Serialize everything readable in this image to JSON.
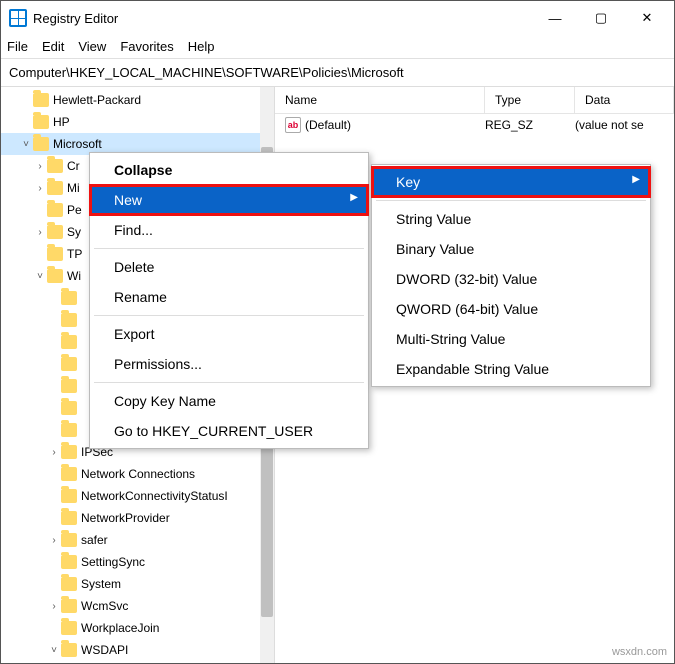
{
  "title": "Registry Editor",
  "menus": {
    "file": "File",
    "edit": "Edit",
    "view": "View",
    "favorites": "Favorites",
    "help": "Help"
  },
  "address": "Computer\\HKEY_LOCAL_MACHINE\\SOFTWARE\\Policies\\Microsoft",
  "valueColumns": {
    "name": "Name",
    "type": "Type",
    "data": "Data"
  },
  "values": [
    {
      "name": "(Default)",
      "type": "REG_SZ",
      "data": "(value not se"
    }
  ],
  "tree": [
    {
      "label": "Hewlett-Packard",
      "indent": 1,
      "tw": ""
    },
    {
      "label": "HP",
      "indent": 1,
      "tw": ""
    },
    {
      "label": "Microsoft",
      "indent": 1,
      "tw": "˅",
      "selected": true
    },
    {
      "label": "Cr",
      "indent": 2,
      "tw": "›"
    },
    {
      "label": "Mi",
      "indent": 2,
      "tw": "›"
    },
    {
      "label": "Pe",
      "indent": 2,
      "tw": ""
    },
    {
      "label": "Sy",
      "indent": 2,
      "tw": "›"
    },
    {
      "label": "TP",
      "indent": 2,
      "tw": ""
    },
    {
      "label": "Wi",
      "indent": 2,
      "tw": "˅"
    },
    {
      "label": "",
      "indent": 3,
      "tw": ""
    },
    {
      "label": "",
      "indent": 3,
      "tw": ""
    },
    {
      "label": "",
      "indent": 3,
      "tw": ""
    },
    {
      "label": "",
      "indent": 3,
      "tw": ""
    },
    {
      "label": "",
      "indent": 3,
      "tw": ""
    },
    {
      "label": "",
      "indent": 3,
      "tw": ""
    },
    {
      "label": "",
      "indent": 3,
      "tw": ""
    },
    {
      "label": "IPSec",
      "indent": 3,
      "tw": "›"
    },
    {
      "label": "Network Connections",
      "indent": 3,
      "tw": ""
    },
    {
      "label": "NetworkConnectivityStatusI",
      "indent": 3,
      "tw": ""
    },
    {
      "label": "NetworkProvider",
      "indent": 3,
      "tw": ""
    },
    {
      "label": "safer",
      "indent": 3,
      "tw": "›"
    },
    {
      "label": "SettingSync",
      "indent": 3,
      "tw": ""
    },
    {
      "label": "System",
      "indent": 3,
      "tw": ""
    },
    {
      "label": "WcmSvc",
      "indent": 3,
      "tw": "›"
    },
    {
      "label": "WorkplaceJoin",
      "indent": 3,
      "tw": ""
    },
    {
      "label": "WSDAPI",
      "indent": 3,
      "tw": "˅"
    }
  ],
  "context": {
    "collapse": "Collapse",
    "new": "New",
    "find": "Find...",
    "delete": "Delete",
    "rename": "Rename",
    "export": "Export",
    "permissions": "Permissions...",
    "copy": "Copy Key Name",
    "goto": "Go to HKEY_CURRENT_USER"
  },
  "submenu": {
    "key": "Key",
    "string": "String Value",
    "binary": "Binary Value",
    "dword": "DWORD (32-bit) Value",
    "qword": "QWORD (64-bit) Value",
    "multi": "Multi-String Value",
    "expand": "Expandable String Value"
  },
  "watermark": "wsxdn.com"
}
